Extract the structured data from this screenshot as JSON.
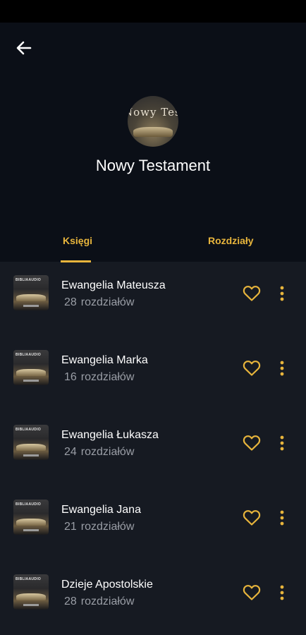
{
  "header": {
    "title": "Nowy Testament",
    "cover_text": "Nowy Testament",
    "back_icon": "arrow-left-icon"
  },
  "tabs": [
    {
      "label": "Księgi",
      "active": true
    },
    {
      "label": "Rozdziały",
      "active": false
    }
  ],
  "thumbnail_label": "BIBLIAAUDIO",
  "chapters_suffix": "rozdziałów",
  "books": [
    {
      "name": "Ewangelia Mateusza",
      "chapters": "28"
    },
    {
      "name": "Ewangelia Marka",
      "chapters": "16"
    },
    {
      "name": "Ewangelia Łukasza",
      "chapters": "24"
    },
    {
      "name": "Ewangelia Jana",
      "chapters": "21"
    },
    {
      "name": "Dzieje Apostolskie",
      "chapters": "28"
    }
  ],
  "colors": {
    "background": "#0b0f17",
    "list_background": "#161a22",
    "accent": "#e8b53c",
    "secondary_text": "#9a9ea6"
  }
}
